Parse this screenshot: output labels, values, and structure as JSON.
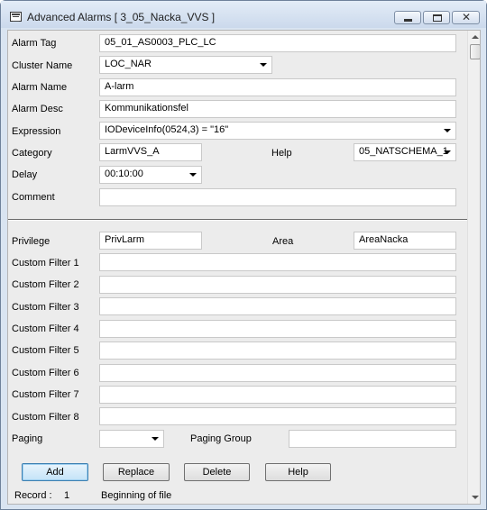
{
  "window": {
    "title": "Advanced Alarms [ 3_05_Nacka_VVS ]",
    "icon": "app-window-icon",
    "controls": {
      "minimize": "minimize-icon",
      "maximize": "maximize-icon",
      "close": "close-icon",
      "close_glyph": "✕"
    }
  },
  "form": {
    "alarm_tag": {
      "label": "Alarm Tag",
      "value": "05_01_AS0003_PLC_LC"
    },
    "cluster_name": {
      "label": "Cluster Name",
      "value": "LOC_NAR"
    },
    "alarm_name": {
      "label": "Alarm Name",
      "value": "A-larm"
    },
    "alarm_desc": {
      "label": "Alarm Desc",
      "value": "Kommunikationsfel"
    },
    "expression": {
      "label": "Expression",
      "value": "IODeviceInfo(0524,3) = \"16\""
    },
    "category": {
      "label": "Category",
      "value": "LarmVVS_A"
    },
    "help": {
      "label": "Help",
      "value": "05_NATSCHEMA_1"
    },
    "delay": {
      "label": "Delay",
      "value": "00:10:00"
    },
    "comment": {
      "label": "Comment",
      "value": ""
    },
    "privilege": {
      "label": "Privilege",
      "value": "PrivLarm"
    },
    "area": {
      "label": "Area",
      "value": "AreaNacka"
    },
    "custom_filters": [
      {
        "label": "Custom Filter 1",
        "value": ""
      },
      {
        "label": "Custom Filter 2",
        "value": ""
      },
      {
        "label": "Custom Filter 3",
        "value": ""
      },
      {
        "label": "Custom Filter 4",
        "value": ""
      },
      {
        "label": "Custom Filter 5",
        "value": ""
      },
      {
        "label": "Custom Filter 6",
        "value": ""
      },
      {
        "label": "Custom Filter 7",
        "value": ""
      },
      {
        "label": "Custom Filter 8",
        "value": ""
      }
    ],
    "paging": {
      "label": "Paging",
      "value": ""
    },
    "paging_group": {
      "label": "Paging Group",
      "value": ""
    }
  },
  "buttons": {
    "add": "Add",
    "replace": "Replace",
    "delete": "Delete",
    "help": "Help"
  },
  "status": {
    "record_label": "Record :",
    "record_number": "1",
    "message": "Beginning of file"
  },
  "colors": {
    "title_bar": "#cbd9ec",
    "dialog_bg": "#ececec",
    "default_button": "#c4e3f8"
  }
}
